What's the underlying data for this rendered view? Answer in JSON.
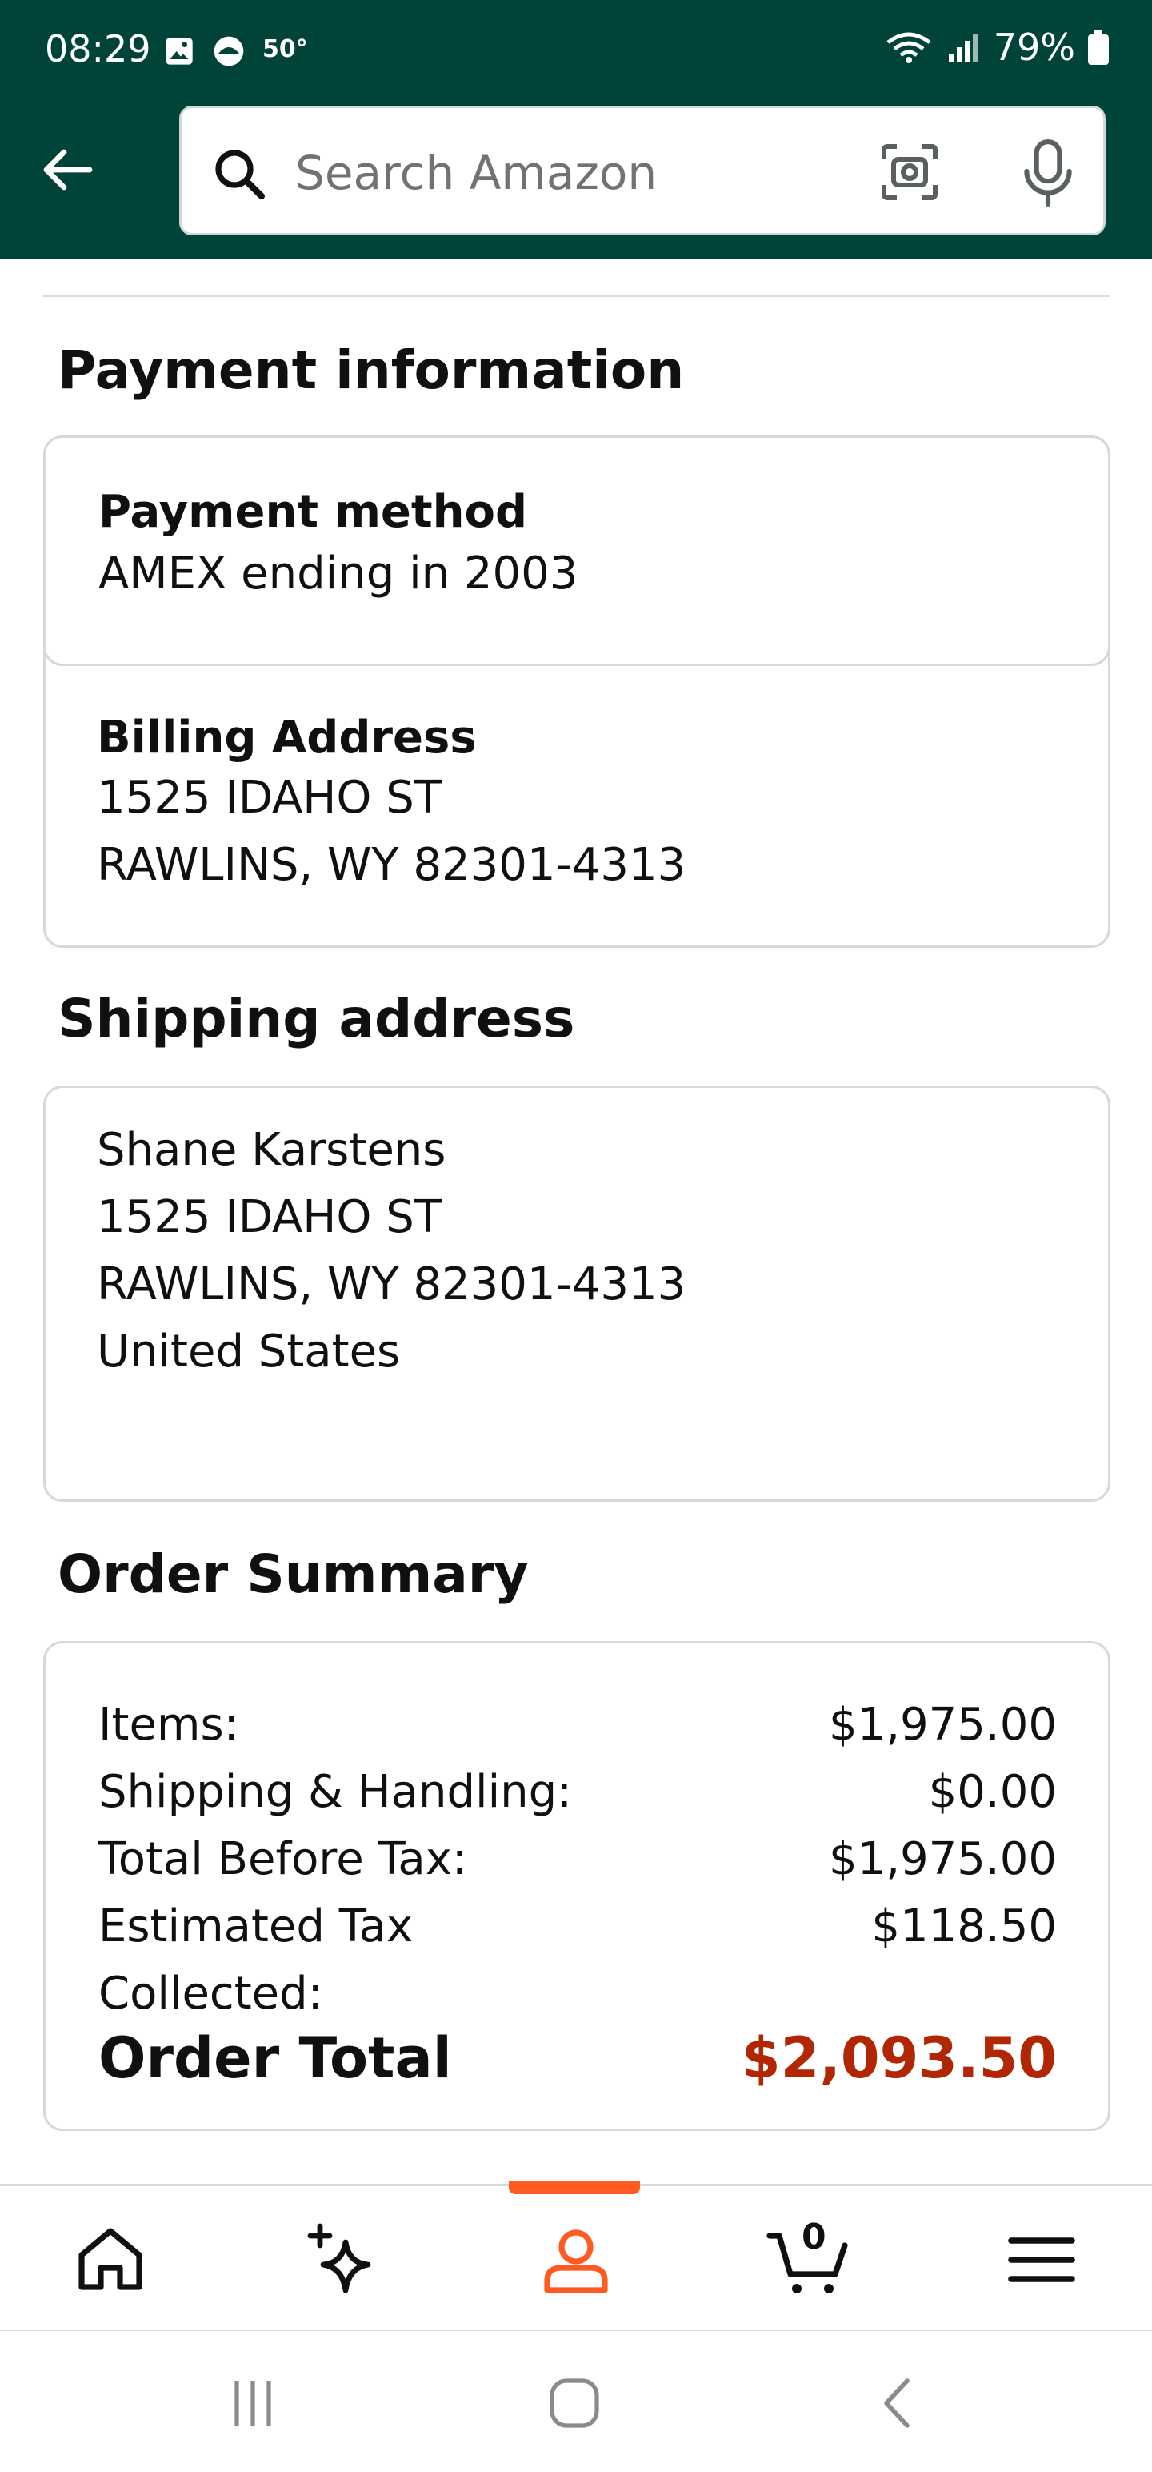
{
  "status_bar": {
    "time": "08:29",
    "temperature": "50°",
    "battery": "79%"
  },
  "search": {
    "placeholder": "Search Amazon"
  },
  "payment": {
    "section_title": "Payment information",
    "method_label": "Payment method",
    "method_value": "AMEX ending in 2003",
    "billing_label": "Billing Address",
    "billing_lines": [
      "1525 IDAHO ST",
      "RAWLINS, WY 82301-4313"
    ]
  },
  "shipping": {
    "section_title": "Shipping address",
    "lines": [
      "Shane Karstens",
      "1525 IDAHO ST",
      "RAWLINS, WY 82301-4313",
      "United States"
    ]
  },
  "summary": {
    "section_title": "Order Summary",
    "rows": [
      {
        "label": "Items:",
        "value": "$1,975.00"
      },
      {
        "label": "Shipping & Handling:",
        "value": "$0.00"
      },
      {
        "label": "Total Before Tax:",
        "value": "$1,975.00"
      },
      {
        "label": "Estimated Tax",
        "value": "$118.50"
      },
      {
        "label": "Collected:",
        "value": ""
      }
    ],
    "total_label": "Order Total",
    "total_value": "$2,093.50",
    "total_color": "#b12704"
  },
  "nav": {
    "cart_count": "0",
    "active_tab": "account",
    "active_color": "#ff5a1f",
    "icons": [
      "home-icon",
      "sparkle-icon",
      "account-icon",
      "cart-icon",
      "menu-icon"
    ]
  }
}
